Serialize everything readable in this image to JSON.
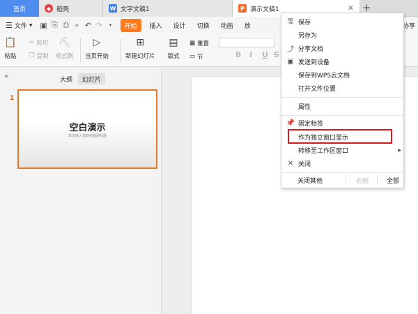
{
  "tabs": {
    "home": "首页",
    "daoke": "稻壳",
    "doc": "文字文稿1",
    "ppt": "演示文稿1",
    "close": "✕",
    "add": "+"
  },
  "menubar": {
    "file": "文件",
    "start": "开始",
    "items": [
      "插入",
      "设计",
      "切换",
      "动画",
      "放"
    ],
    "share": "协享"
  },
  "ribbon": {
    "paste": "粘贴",
    "cut": "剪切",
    "copy": "复制",
    "format_painter": "格式刷",
    "play_current": "当页开始",
    "new_slide": "新建幻灯片",
    "layout": "版式",
    "section": "节",
    "reset": "重置",
    "format_buttons": [
      "B",
      "I",
      "U",
      "S"
    ]
  },
  "left_pane": {
    "collapse": "«",
    "tab_outline": "大纲",
    "tab_slides": "幻灯片",
    "slide_number": "1",
    "slide_title": "空白演示",
    "slide_subtitle": "单击输入您的封面副标题"
  },
  "context_menu": {
    "items": [
      {
        "icon": "save-icon",
        "label": "保存"
      },
      {
        "icon": "",
        "label": "另存为"
      },
      {
        "icon": "share-icon",
        "label": "分享文档"
      },
      {
        "icon": "send-device-icon",
        "label": "发送到设备"
      },
      {
        "icon": "",
        "label": "保存到WPS云文档"
      },
      {
        "icon": "",
        "label": "打开文件位置"
      },
      {
        "icon": "",
        "label": "属性"
      },
      {
        "icon": "pin-icon",
        "label": "固定标签"
      },
      {
        "icon": "",
        "label": "作为独立窗口显示"
      },
      {
        "icon": "",
        "label": "转移至工作区窗口"
      },
      {
        "icon": "close-icon",
        "label": "关闭"
      }
    ],
    "footer": {
      "close_others": "关闭其他",
      "right": "右侧",
      "all": "全部"
    },
    "highlighted_item": "作为独立窗口显示"
  },
  "colors": {
    "home_tab": "#4e8cf0",
    "start_button": "#ff7a1a",
    "thumb_border": "#e87723",
    "highlight_box": "#e0191c"
  }
}
